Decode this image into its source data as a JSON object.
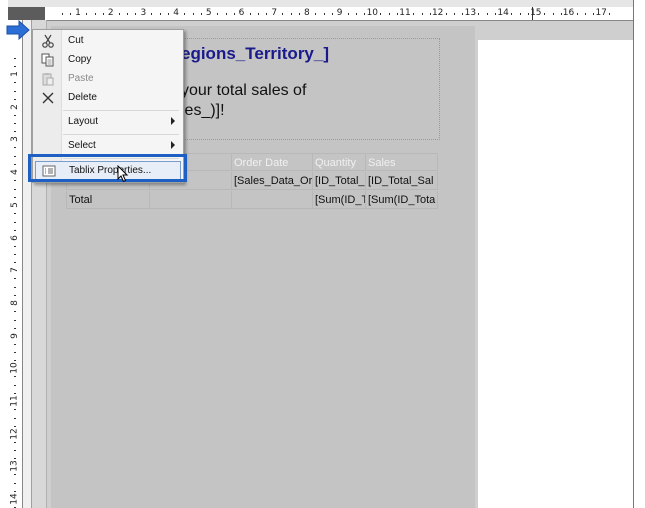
{
  "ruler": {
    "horizontal_labels": [
      "1",
      "2",
      "3",
      "4",
      "5",
      "6",
      "7",
      "8",
      "9",
      "10",
      "11",
      "12",
      "13",
      "14",
      "15",
      "16",
      "17"
    ],
    "vertical_labels": [
      "1",
      "2",
      "3",
      "4",
      "5",
      "6",
      "7",
      "8",
      "9",
      "10",
      "11",
      "12",
      "13",
      "14"
    ]
  },
  "report": {
    "title": "egions_Territory_]",
    "message_line1": "your total sales of",
    "message_line2": "les_)]!"
  },
  "tablix": {
    "headers": [
      "Order Date",
      "Quantity",
      "Sales"
    ],
    "detail_row": [
      "[Sales_Data_Or",
      "[ID_Total_",
      "[ID_Total_Sal"
    ],
    "total_row": {
      "label": "Total",
      "quantity": "[Sum(ID_T",
      "sales": "[Sum(ID_Tota"
    }
  },
  "context_menu": {
    "items": [
      {
        "label": "Cut",
        "icon": "scissors-icon",
        "enabled": true
      },
      {
        "label": "Copy",
        "icon": "copy-icon",
        "enabled": true
      },
      {
        "label": "Paste",
        "icon": "paste-icon",
        "enabled": false
      },
      {
        "label": "Delete",
        "icon": "delete-x-icon",
        "enabled": true
      },
      {
        "label": "Layout",
        "submenu": true
      },
      {
        "label": "Select",
        "submenu": true
      },
      {
        "label": "Tablix Properties...",
        "icon": "properties-icon",
        "highlighted": true
      }
    ]
  },
  "colors": {
    "highlight_border": "#1e5fc4",
    "title_text": "#1a1a8c",
    "canvas": "#c4c4c4"
  }
}
